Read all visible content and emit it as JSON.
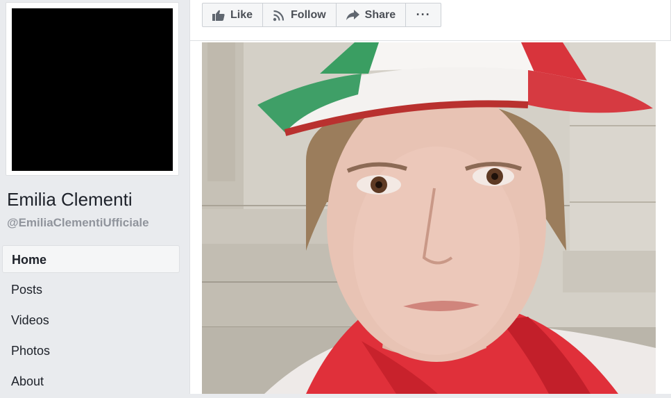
{
  "profile": {
    "name": "Emilia Clementi",
    "handle": "@EmiliaClementiUfficiale"
  },
  "nav": {
    "items": [
      {
        "label": "Home",
        "active": true
      },
      {
        "label": "Posts",
        "active": false
      },
      {
        "label": "Videos",
        "active": false
      },
      {
        "label": "Photos",
        "active": false
      },
      {
        "label": "About",
        "active": false
      }
    ]
  },
  "actions": {
    "like_label": "Like",
    "follow_label": "Follow",
    "share_label": "Share",
    "more_label": "···"
  },
  "icons": {
    "like": "thumbs-up-icon",
    "follow": "rss-icon",
    "share": "share-arrow-icon",
    "more": "ellipsis-icon"
  },
  "colors": {
    "page_bg": "#e9ebee",
    "text": "#1d2129",
    "muted": "#90949c",
    "button_text": "#4b4f56"
  }
}
